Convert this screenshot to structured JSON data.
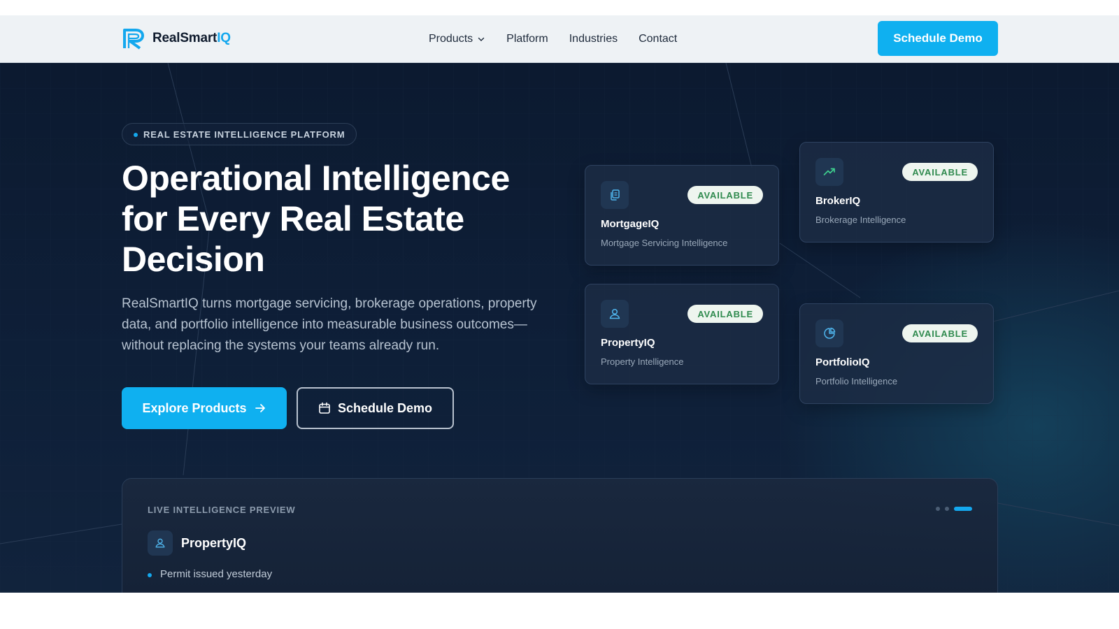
{
  "nav": {
    "brand_main": "RealSmart",
    "brand_accent": "IQ",
    "links": [
      "Products",
      "Platform",
      "Industries",
      "Contact"
    ],
    "cta": "Schedule Demo"
  },
  "hero": {
    "eyebrow": "REAL ESTATE INTELLIGENCE PLATFORM",
    "title": "Operational Intelligence for Every Real Estate Decision",
    "lead": "RealSmartIQ turns mortgage servicing, brokerage operations, property data, and portfolio intelligence into measurable business outcomes—without replacing the systems your teams already run.",
    "primary_cta": "Explore Products",
    "secondary_cta": "Schedule Demo"
  },
  "cards": [
    {
      "name": "MortgageIQ",
      "desc": "Mortgage Servicing Intelligence",
      "badge": "AVAILABLE",
      "icon": "copy-icon"
    },
    {
      "name": "BrokerIQ",
      "desc": "Brokerage Intelligence",
      "badge": "AVAILABLE",
      "icon": "trending-up-icon"
    },
    {
      "name": "PropertyIQ",
      "desc": "Property Intelligence",
      "badge": "AVAILABLE",
      "icon": "user-pin-icon"
    },
    {
      "name": "PortfolioIQ",
      "desc": "Portfolio Intelligence",
      "badge": "AVAILABLE",
      "icon": "pie-chart-icon"
    }
  ],
  "preview": {
    "label": "LIVE INTELLIGENCE PREVIEW",
    "product": "PropertyIQ",
    "item": "Permit issued yesterday",
    "active_dot": 3,
    "dot_count": 3
  },
  "colors": {
    "accent": "#0fb0f0",
    "badge_text": "#2f8a4e",
    "hero_bg": "#0c1a30"
  }
}
